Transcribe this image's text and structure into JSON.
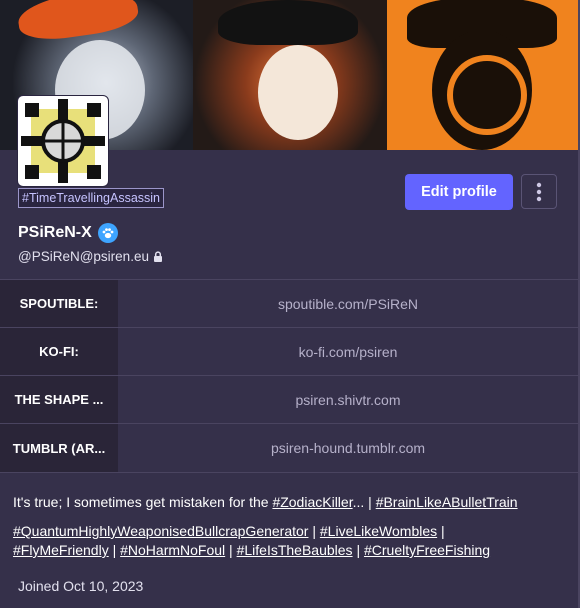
{
  "profile": {
    "hashtag_badge": "#TimeTravellingAssassin",
    "display_name": "PSiReN-X",
    "handle": "@PSiReN@psiren.eu",
    "edit_profile_label": "Edit profile",
    "joined": "Joined Oct 10, 2023"
  },
  "fields": [
    {
      "name": "SPOUTIBLE:",
      "value": "spoutible.com/PSiReN"
    },
    {
      "name": "KO-FI:",
      "value": "ko-fi.com/psiren"
    },
    {
      "name": "THE SHAPE ...",
      "value": "psiren.shivtr.com"
    },
    {
      "name": "TUMBLR (AR...",
      "value": "psiren-hound.tumblr.com"
    }
  ],
  "bio": {
    "line1_text": "It's true; I sometimes get mistaken for the ",
    "line1_tag1": "#ZodiacKiller",
    "line1_mid": "... | ",
    "line1_tag2": "#BrainLikeABulletTrain",
    "tag3": "#QuantumHighlyWeaponisedBullcrapGenerator",
    "sep": " | ",
    "tag4": "#LiveLikeWombles",
    "tag5": "#FlyMeFriendly",
    "tag6": "#NoHarmNoFoul",
    "tag7": "#LifeIsTheBaubles",
    "tag8": "#CrueltyFreeFishing"
  },
  "icons": {
    "verified": "paw-badge-icon",
    "lock": "lock-icon",
    "menu": "kebab-menu-icon"
  },
  "colors": {
    "accent": "#6364ff",
    "background": "#35304a",
    "field_name_bg": "#2a2538",
    "verified_badge": "#3ea4ff"
  }
}
